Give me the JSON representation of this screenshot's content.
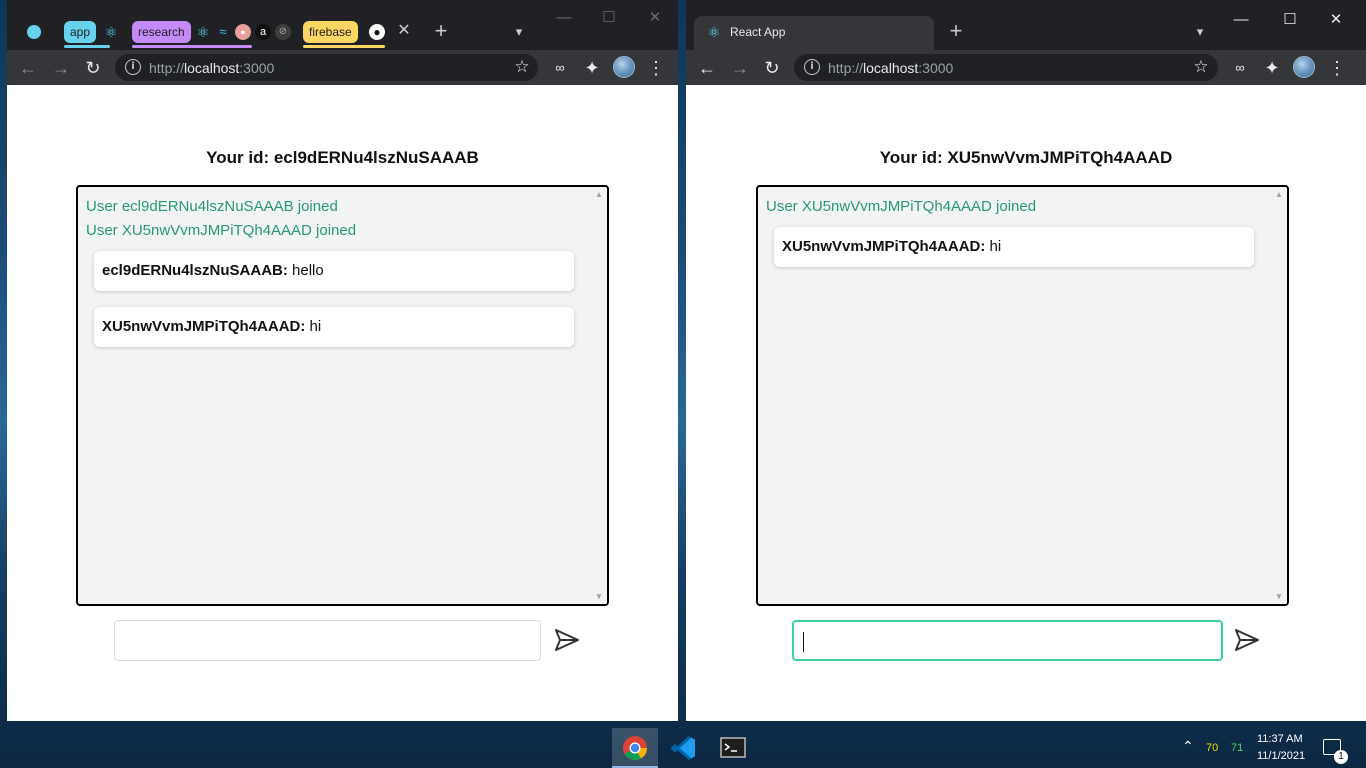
{
  "left_window": {
    "tab_groups": [
      {
        "label": "app",
        "color": "#66d2ec"
      },
      {
        "label": "research",
        "color": "#c58af9"
      },
      {
        "label": "firebase",
        "color": "#fdd663"
      }
    ],
    "url_scheme": "http://",
    "url_host": "localhost",
    "url_port": ":3000",
    "page": {
      "title_prefix": "Your id: ",
      "user_id": "ecl9dERNu4lszNuSAAAB",
      "join_messages": [
        "User ecl9dERNu4lszNuSAAAB joined",
        "User XU5nwVvmJMPiTQh4AAAD joined"
      ],
      "messages": [
        {
          "sender": "ecl9dERNu4lszNuSAAAB:",
          "text": " hello"
        },
        {
          "sender": "XU5nwVvmJMPiTQh4AAAD:",
          "text": " hi"
        }
      ],
      "input_value": ""
    }
  },
  "right_window": {
    "tab_title": "React App",
    "url_scheme": "http://",
    "url_host": "localhost",
    "url_port": ":3000",
    "page": {
      "title_prefix": "Your id: ",
      "user_id": "XU5nwVvmJMPiTQh4AAAD",
      "join_messages": [
        "User XU5nwVvmJMPiTQh4AAAD joined"
      ],
      "messages": [
        {
          "sender": "XU5nwVvmJMPiTQh4AAAD:",
          "text": " hi"
        }
      ],
      "input_value": ""
    }
  },
  "taskbar": {
    "apps": [
      "chrome-icon",
      "vscode-icon",
      "terminal-icon"
    ],
    "tray_value_1": "70",
    "tray_value_2": "71",
    "time": "11:37 AM",
    "date": "11/1/2021",
    "notification_count": "1"
  },
  "colors": {
    "join_text": "#2a9a6a",
    "focus_ring": "#3fd0a2",
    "chrome_dark": "#202124",
    "chrome_toolbar": "#35363a"
  }
}
